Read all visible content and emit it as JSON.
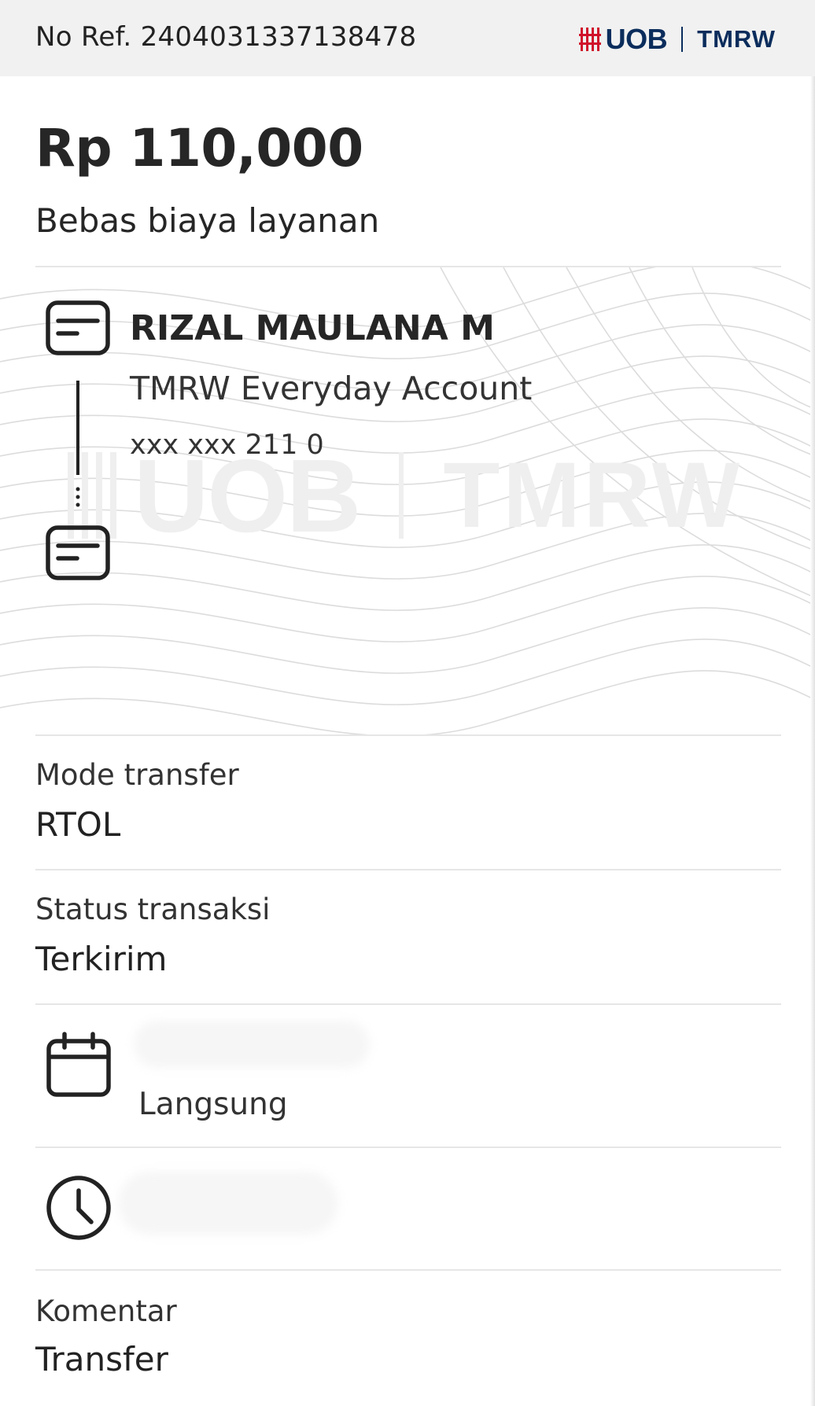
{
  "header": {
    "reference": "No Ref. 2404031337138478",
    "logo_brand": "UOB",
    "logo_product": "TMRW"
  },
  "summary": {
    "amount": "Rp 110,000",
    "fee_note": "Bebas biaya layanan"
  },
  "recipient": {
    "name": "RIZAL MAULANA M",
    "account_type": "TMRW Everyday Account",
    "account_number": "xxx xxx 211 0",
    "icon": "card-icon"
  },
  "details": {
    "transfer_mode_label": "Mode transfer",
    "transfer_mode_value": "RTOL",
    "status_label": "Status transaksi",
    "status_value": "Terkirim",
    "schedule_icon": "calendar-icon",
    "schedule_value": "Langsung",
    "time_icon": "clock-icon",
    "comment_label": "Komentar",
    "comment_value": "Transfer"
  },
  "colors": {
    "brand_navy": "#0b2d5c",
    "brand_red": "#d0112b",
    "header_bg": "#f1f1f1",
    "text": "#262626"
  }
}
